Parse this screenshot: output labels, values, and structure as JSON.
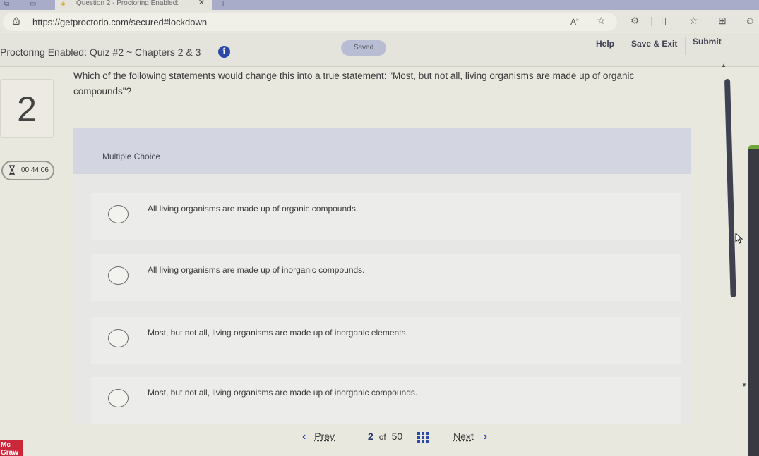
{
  "browser": {
    "tab_title": "Question 2 - Proctoring Enabled:",
    "url": "https://getproctorio.com/secured#lockdown",
    "toolbar_icons": [
      "read-aloud-icon",
      "favorite-star-icon",
      "extensions-icon",
      "split-screen-icon",
      "favorites-list-icon",
      "collections-icon",
      "profile-icon"
    ]
  },
  "header": {
    "title": "Proctoring Enabled: Quiz #2 ~ Chapters 2 & 3",
    "info_glyph": "i",
    "status": "Saved",
    "buttons": {
      "help": "Help",
      "save_exit": "Save & Exit",
      "submit": "Submit"
    }
  },
  "question": {
    "number": "2",
    "text": "Which of the following statements would change this into a true statement: \"Most, but not all, living organisms are made up of organic compounds\"?",
    "type": "Multiple Choice",
    "choices": [
      {
        "label": "All living organisms are made up of organic compounds.",
        "selected": false
      },
      {
        "label": "All living organisms are made up of inorganic compounds.",
        "selected": false
      },
      {
        "label": "Most, but not all, living organisms are made up of inorganic elements.",
        "selected": false
      },
      {
        "label": "Most, but not all, living organisms are made up of inorganic compounds.",
        "selected": false
      }
    ]
  },
  "timer": {
    "value": "00:44:06"
  },
  "navigation": {
    "prev": "Prev",
    "next": "Next",
    "current_page": "2",
    "of_label": "of",
    "total_pages": "50"
  },
  "brand": {
    "line1": "Mc",
    "line2": "Graw"
  },
  "colors": {
    "accent": "#2b4aa8",
    "brand_red": "#c8283a",
    "panel_green": "#6da838"
  }
}
